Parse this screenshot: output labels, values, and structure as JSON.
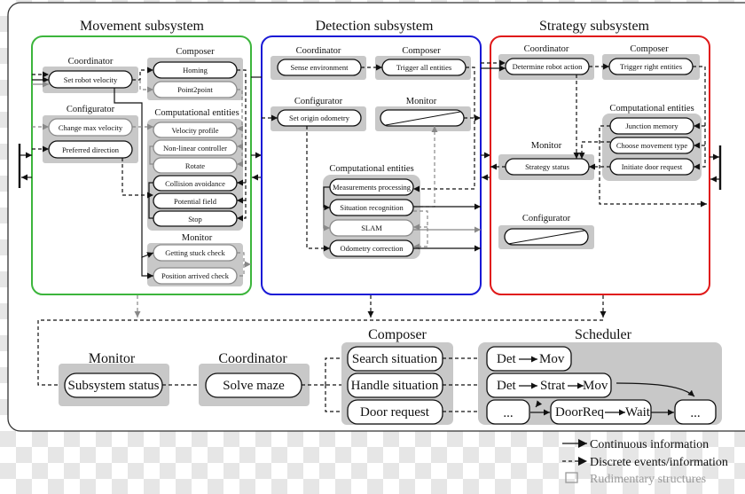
{
  "colors": {
    "movement": "#3cb53c",
    "detection": "#1a1ad6",
    "strategy": "#e01919",
    "group_fill": "#c8c8c8",
    "rudimentary": "#8a8a8a"
  },
  "movement": {
    "title": "Movement subsystem",
    "coordinator": {
      "label": "Coordinator",
      "items": [
        "Set robot velocity"
      ]
    },
    "configurator": {
      "label": "Configurator",
      "items": [
        "Change max velocity",
        "Preferred direction"
      ]
    },
    "composer": {
      "label": "Composer",
      "items": [
        "Homing",
        "Point2point"
      ]
    },
    "entities": {
      "label": "Computational entities",
      "items": [
        "Velocity profile",
        "Non-linear controller",
        "Rotate",
        "Collision avoidance",
        "Potential field",
        "Stop"
      ]
    },
    "monitor": {
      "label": "Monitor",
      "items": [
        "Getting stuck check",
        "Position arrived check"
      ]
    }
  },
  "detection": {
    "title": "Detection subsystem",
    "coordinator": {
      "label": "Coordinator",
      "items": [
        "Sense environment"
      ]
    },
    "composer": {
      "label": "Composer",
      "items": [
        "Trigger all entities"
      ]
    },
    "configurator": {
      "label": "Configurator",
      "items": [
        "Set origin odometry"
      ]
    },
    "monitor": {
      "label": "Monitor",
      "items": [
        ""
      ]
    },
    "entities": {
      "label": "Computational entities",
      "items": [
        "Measurements processing",
        "Situation recognition",
        "SLAM",
        "Odometry correction"
      ]
    }
  },
  "strategy": {
    "title": "Strategy subsystem",
    "coordinator": {
      "label": "Coordinator",
      "items": [
        "Determine robot action"
      ]
    },
    "composer": {
      "label": "Composer",
      "items": [
        "Trigger right entities"
      ]
    },
    "entities": {
      "label": "Computational entities",
      "items": [
        "Junction memory",
        "Choose movement type",
        "Initiate door request"
      ]
    },
    "monitor": {
      "label": "Monitor",
      "items": [
        "Strategy status"
      ]
    },
    "configurator": {
      "label": "Configurator",
      "items": [
        ""
      ]
    }
  },
  "top": {
    "monitor": {
      "label": "Monitor",
      "items": [
        "Subsystem status"
      ]
    },
    "coordinator": {
      "label": "Coordinator",
      "items": [
        "Solve maze"
      ]
    },
    "composer": {
      "label": "Composer",
      "items": [
        "Search situation",
        "Handle situation",
        "Door request"
      ]
    },
    "scheduler": {
      "label": "Scheduler",
      "row1": [
        "Det",
        "Mov"
      ],
      "row2": [
        "Det",
        "Strat",
        "Mov"
      ],
      "row3": [
        "...",
        "DoorReq",
        "Wait",
        "..."
      ]
    }
  },
  "legend": {
    "continuous": "Continuous information",
    "discrete": "Discrete events/information",
    "rudimentary": "Rudimentary structures"
  }
}
